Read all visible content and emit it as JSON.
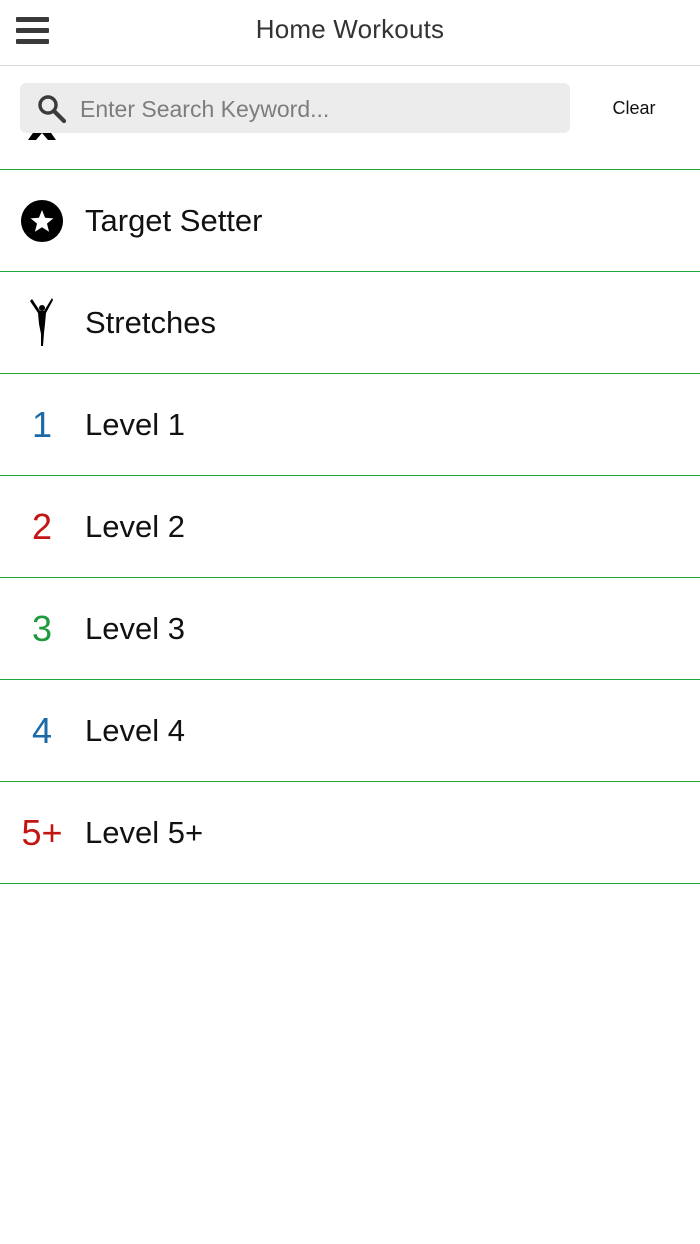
{
  "header": {
    "title": "Home Workouts",
    "menu_icon": "hamburger-menu-icon"
  },
  "search": {
    "placeholder": "Enter Search Keyword...",
    "value": "",
    "icon": "search-icon",
    "clear_label": "Clear"
  },
  "list": {
    "divider_color": "#22a83a",
    "items": [
      {
        "label": "",
        "icon": "ribbon-icon"
      },
      {
        "label": "Target Setter",
        "icon": "star-circle-icon"
      },
      {
        "label": "Stretches",
        "icon": "stretching-figure-icon"
      },
      {
        "label": "Level 1",
        "icon_text": "1",
        "icon_color": "#1a6aa8"
      },
      {
        "label": "Level 2",
        "icon_text": "2",
        "icon_color": "#c41515"
      },
      {
        "label": "Level 3",
        "icon_text": "3",
        "icon_color": "#1e9a3c"
      },
      {
        "label": "Level 4",
        "icon_text": "4",
        "icon_color": "#1a6aa8"
      },
      {
        "label": "Level 5+",
        "icon_text": "5+",
        "icon_color": "#c41515"
      }
    ]
  }
}
